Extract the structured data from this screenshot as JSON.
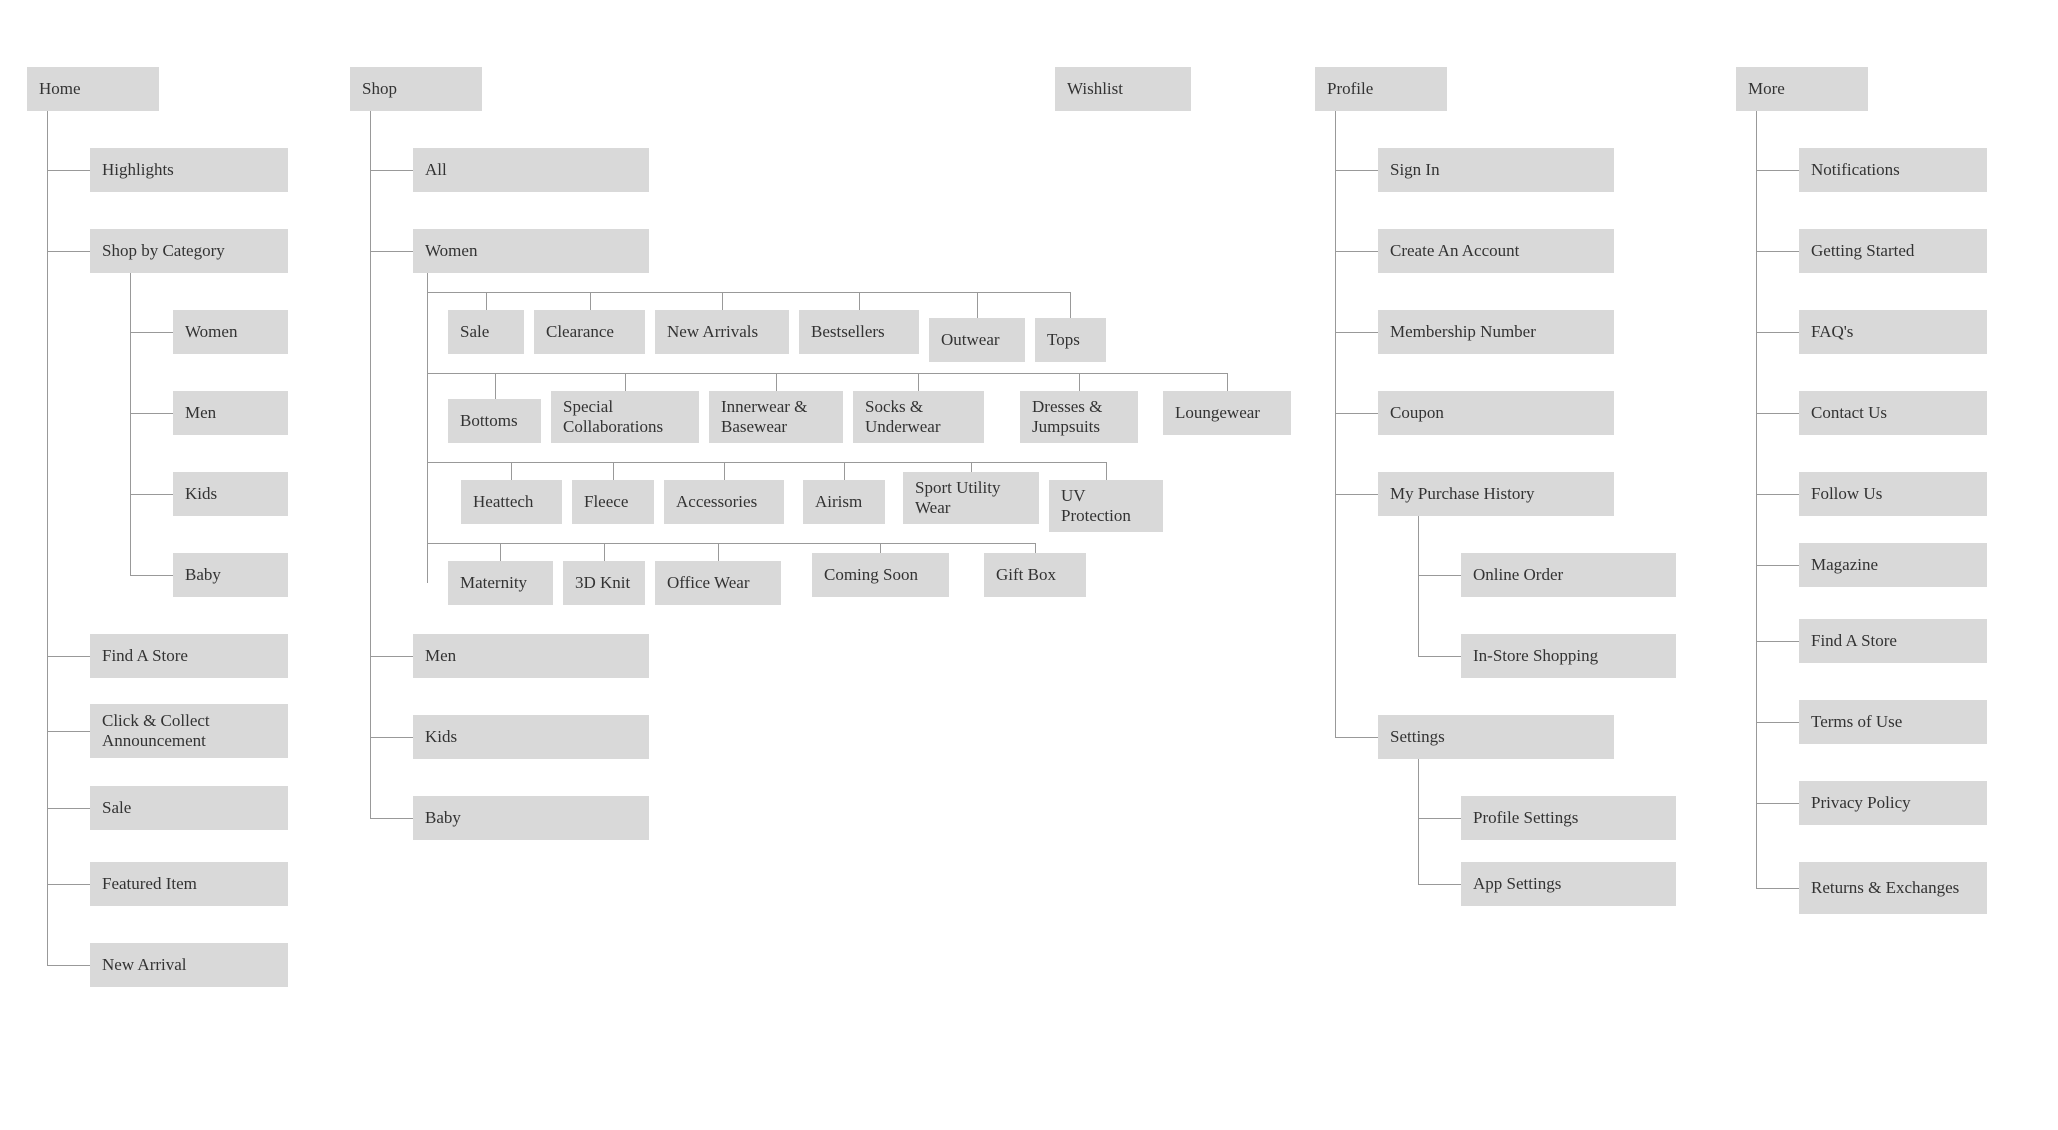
{
  "home": {
    "label": "Home",
    "children": {
      "highlights": "Highlights",
      "shop_by_category": {
        "label": "Shop by Category",
        "children": {
          "women": "Women",
          "men": "Men",
          "kids": "Kids",
          "baby": "Baby"
        }
      },
      "find_a_store": "Find A Store",
      "click_collect": "Click & Collect Announcement",
      "sale": "Sale",
      "featured_item": "Featured Item",
      "new_arrival": "New Arrival"
    }
  },
  "shop": {
    "label": "Shop",
    "children": {
      "all": "All",
      "women": {
        "label": "Women",
        "row1": {
          "sale": "Sale",
          "clearance": "Clearance",
          "new_arrivals": "New Arrivals",
          "bestsellers": "Bestsellers",
          "outwear": "Outwear",
          "tops": "Tops"
        },
        "row2": {
          "bottoms": "Bottoms",
          "special_collab": "Special Collaborations",
          "innerwear": "Innerwear & Basewear",
          "socks": "Socks & Underwear",
          "dresses": "Dresses & Jumpsuits",
          "loungewear": "Loungewear"
        },
        "row3": {
          "heattech": "Heattech",
          "fleece": "Fleece",
          "accessories": "Accessories",
          "airism": "Airism",
          "sport": "Sport Utility Wear",
          "uv": "UV Protection"
        },
        "row4": {
          "maternity": "Maternity",
          "knit3d": "3D Knit",
          "office": "Office Wear",
          "coming": "Coming Soon",
          "giftbox": "Gift Box"
        }
      },
      "men": "Men",
      "kids": "Kids",
      "baby": "Baby"
    }
  },
  "wishlist": {
    "label": "Wishlist"
  },
  "profile": {
    "label": "Profile",
    "children": {
      "sign_in": "Sign In",
      "create": "Create An Account",
      "membership": "Membership Number",
      "coupon": "Coupon",
      "purchase": {
        "label": "My Purchase History",
        "children": {
          "online": "Online Order",
          "instore": "In-Store Shopping"
        }
      },
      "settings": {
        "label": "Settings",
        "children": {
          "profile": "Profile Settings",
          "app": "App Settings"
        }
      }
    }
  },
  "more": {
    "label": "More",
    "children": {
      "notifications": "Notifications",
      "getting_started": "Getting Started",
      "faqs": "FAQ's",
      "contact": "Contact Us",
      "follow": "Follow Us",
      "magazine": "Magazine",
      "find_store": "Find A Store",
      "terms": "Terms of Use",
      "privacy": "Privacy Policy",
      "returns": "Returns & Exchanges"
    }
  }
}
